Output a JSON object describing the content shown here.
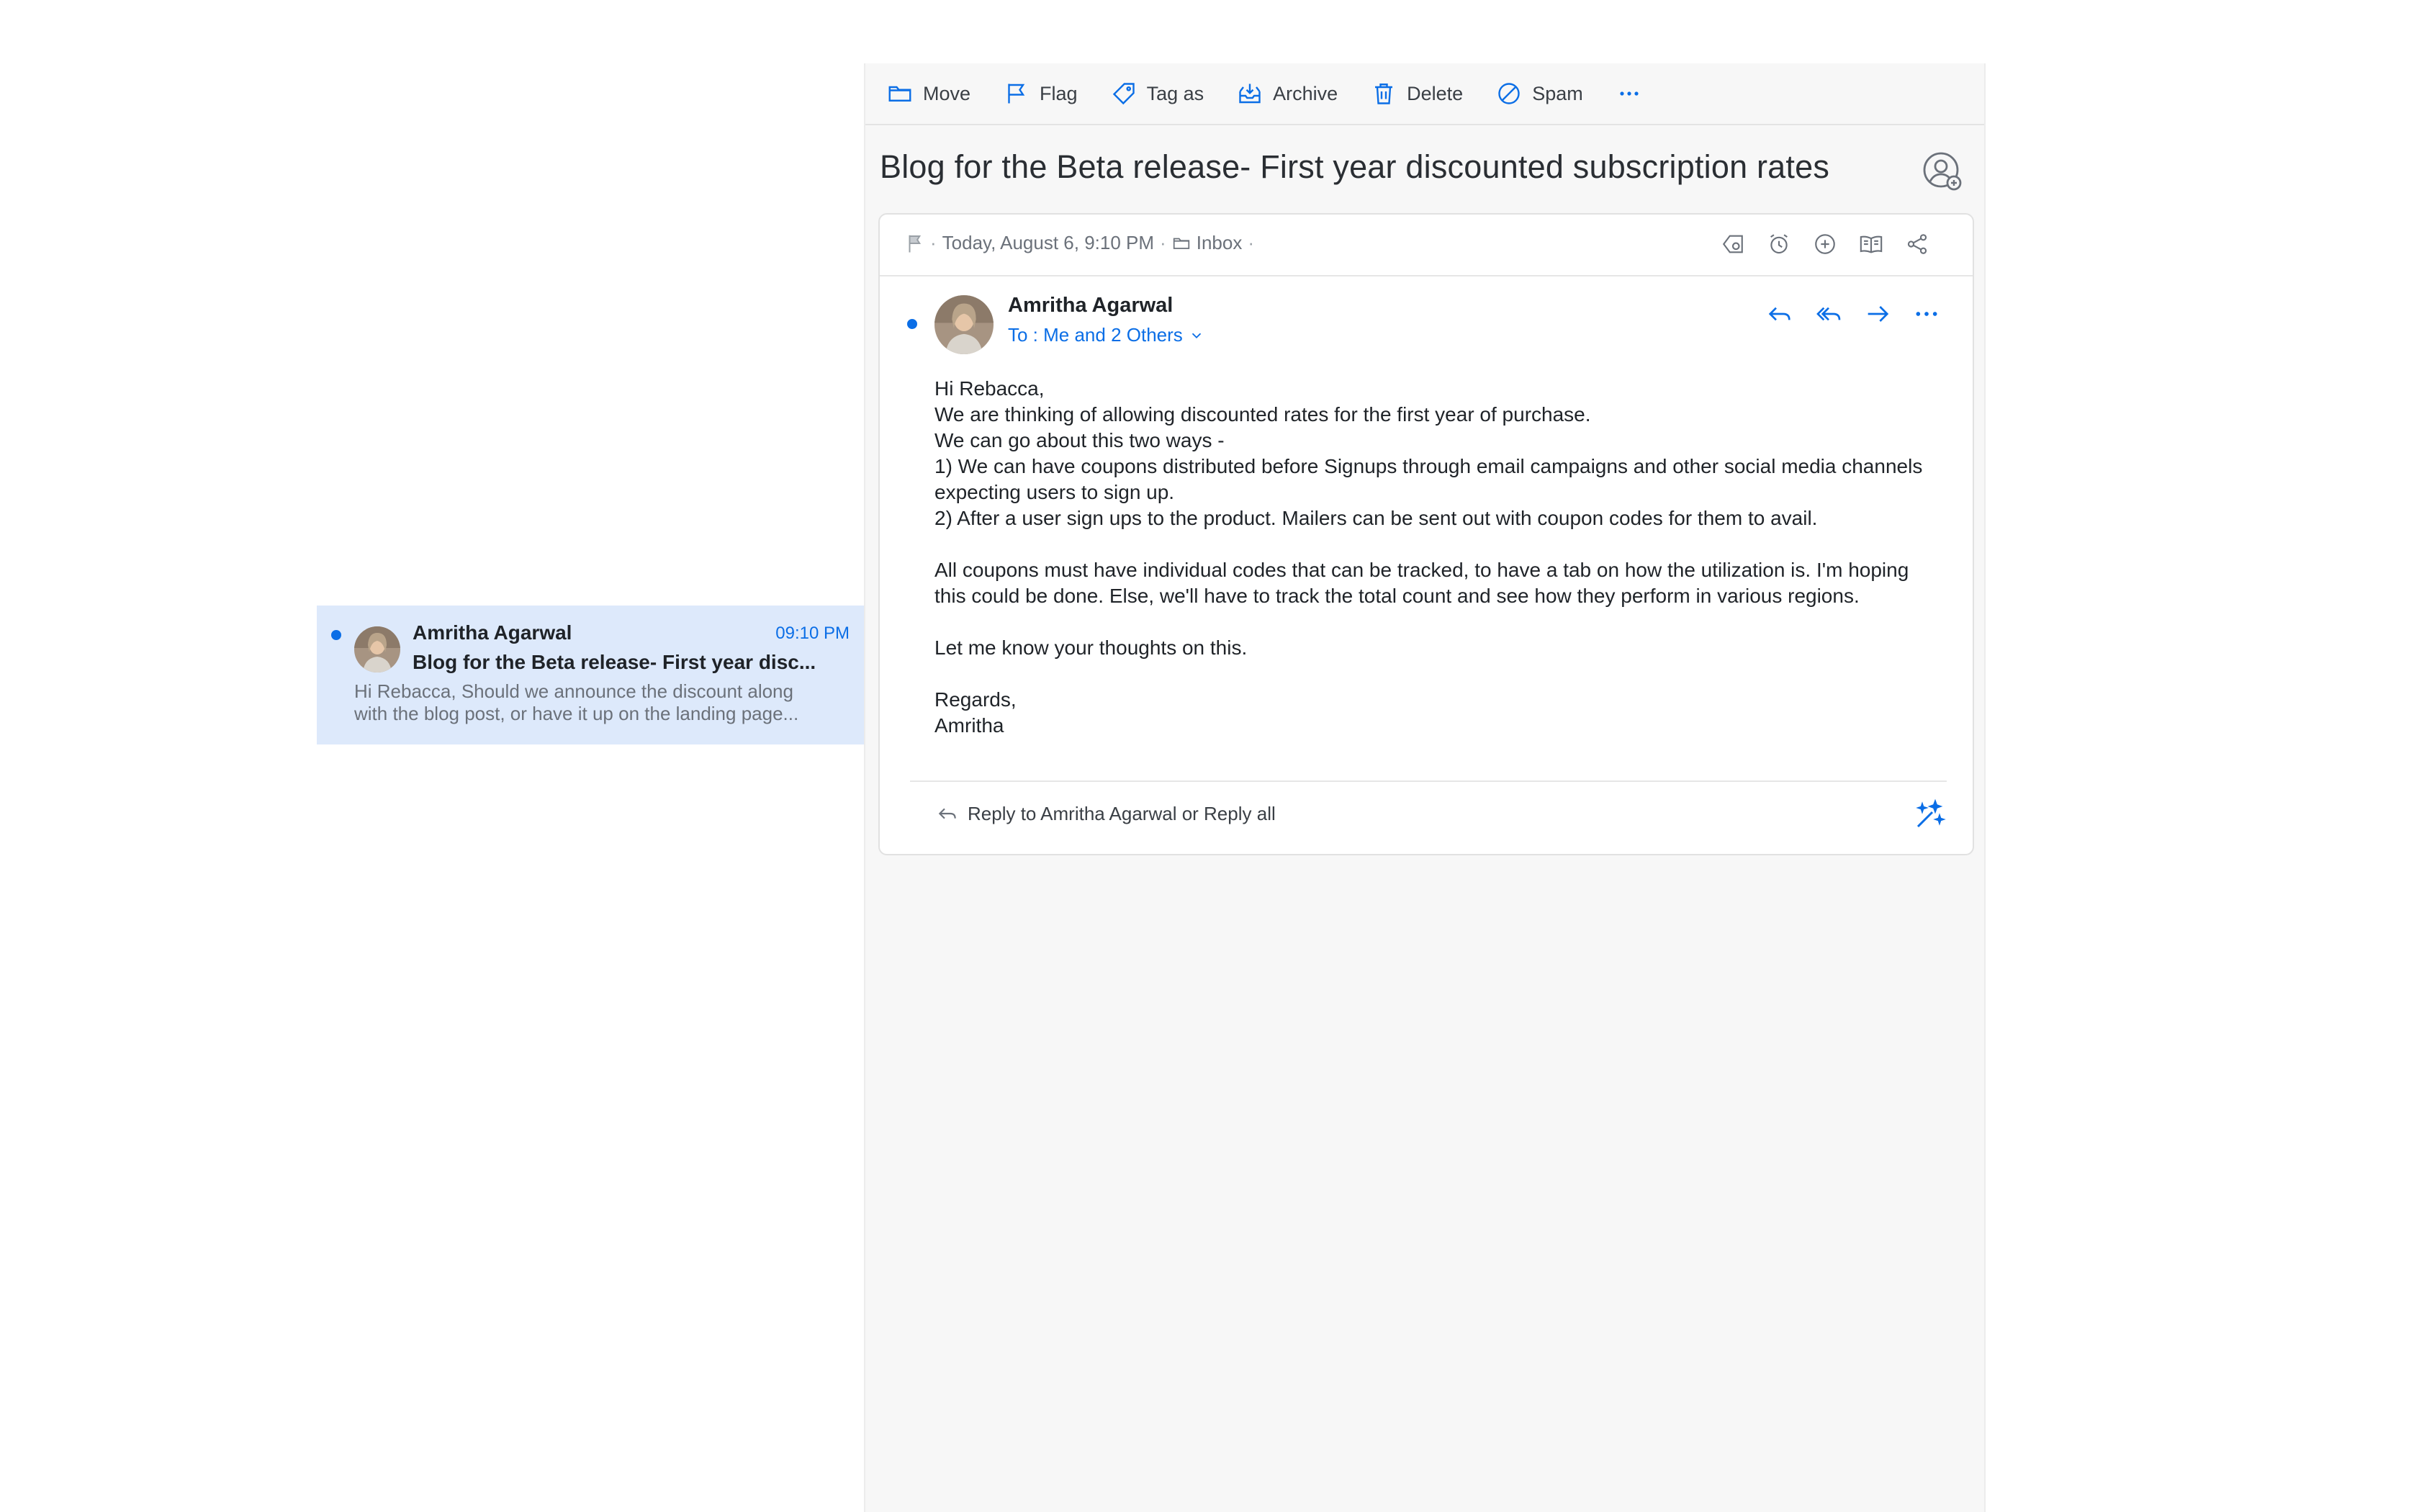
{
  "list": {
    "item": {
      "sender": "Amritha Agarwal",
      "time": "09:10 PM",
      "subject": "Blog for the Beta release- First year disc...",
      "preview": "Hi Rebacca, Should we announce the discount along with the blog post, or have it up on the landing page..."
    }
  },
  "toolbar": {
    "move": "Move",
    "flag": "Flag",
    "tag": "Tag as",
    "archive": "Archive",
    "delete": "Delete",
    "spam": "Spam"
  },
  "message": {
    "title": "Blog for the Beta release- First year discounted subscription rates",
    "date": "Today, August 6, 9:10 PM",
    "folder": "Inbox",
    "sender": "Amritha Agarwal",
    "to": "To : Me and 2 Others",
    "body": {
      "l1": "Hi Rebacca,",
      "l2": "We are thinking of allowing discounted rates for the first year of purchase.",
      "l3": "We can go about this two ways -",
      "l4": "1) We can have coupons distributed before Signups through email campaigns and other social media channels expecting users to sign up.",
      "l5": "2) After a user sign ups to the product. Mailers can be sent out with coupon codes for them to avail.",
      "l6": "All coupons must have individual codes that can be tracked, to have a tab on how the utilization is. I'm hoping this could be done. Else, we'll have to track the total count and see how they perform in various regions.",
      "l7": "Let me know your thoughts on this.",
      "l8": "Regards,",
      "l9": "Amritha"
    },
    "reply_prompt": "Reply to Amritha Agarwal or Reply all"
  },
  "colors": {
    "accent": "#0b6ee6",
    "selected_bg": "#dde9fb",
    "pane_bg": "#f7f7f7"
  },
  "icons": [
    "folder-icon",
    "flag-icon",
    "tag-icon",
    "archive-icon",
    "trash-icon",
    "spam-icon",
    "more-icon",
    "contact-icon",
    "reply-icon",
    "reply-all-icon",
    "forward-icon",
    "magic-wand-icon"
  ]
}
